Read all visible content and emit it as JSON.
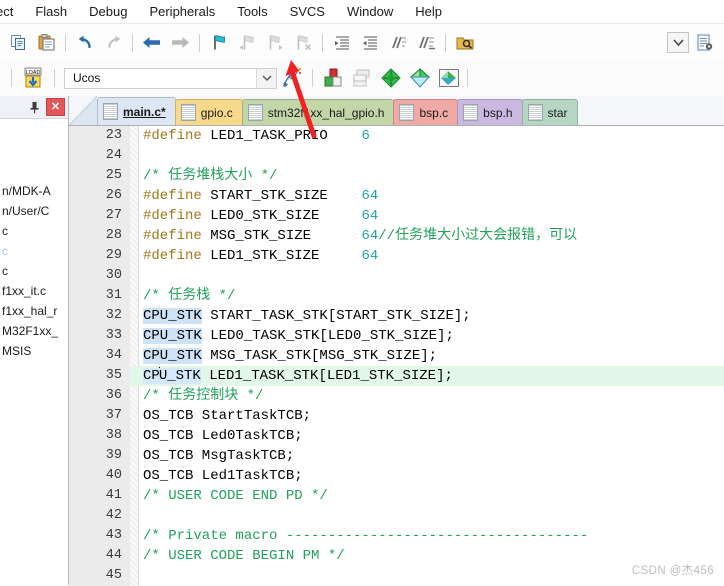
{
  "window": {
    "app": "Keil uVision IDE"
  },
  "menubar": {
    "items": [
      {
        "label": "ect",
        "name": "menu-project"
      },
      {
        "label": "Flash",
        "name": "menu-flash"
      },
      {
        "label": "Debug",
        "name": "menu-debug"
      },
      {
        "label": "Peripherals",
        "name": "menu-peripherals"
      },
      {
        "label": "Tools",
        "name": "menu-tools"
      },
      {
        "label": "SVCS",
        "name": "menu-svcs"
      },
      {
        "label": "Window",
        "name": "menu-window"
      },
      {
        "label": "Help",
        "name": "menu-help"
      }
    ]
  },
  "toolbar1": {
    "buttons": [
      {
        "icon": "copy-icon",
        "tooltip": "Copy"
      },
      {
        "icon": "paste-icon",
        "tooltip": "Paste"
      },
      {
        "icon": "undo-icon",
        "tooltip": "Undo"
      },
      {
        "icon": "redo-icon",
        "tooltip": "Redo"
      },
      {
        "icon": "navigate-back-icon",
        "tooltip": "Back"
      },
      {
        "icon": "navigate-forward-icon",
        "tooltip": "Forward"
      },
      {
        "icon": "bookmark-toggle-icon",
        "tooltip": "Insert/Remove Bookmark"
      },
      {
        "icon": "bookmark-prev-icon",
        "tooltip": "Previous Bookmark"
      },
      {
        "icon": "bookmark-next-icon",
        "tooltip": "Next Bookmark"
      },
      {
        "icon": "bookmark-clear-icon",
        "tooltip": "Clear All Bookmarks"
      },
      {
        "icon": "indent-increase-icon",
        "tooltip": "Indent Selected Text"
      },
      {
        "icon": "indent-decrease-icon",
        "tooltip": "Unindent Selected Text"
      },
      {
        "icon": "comment-lines-icon",
        "tooltip": "Comment Selection"
      },
      {
        "icon": "uncomment-lines-icon",
        "tooltip": "Uncomment Selection"
      },
      {
        "icon": "find-in-files-icon",
        "tooltip": "Find in Files"
      }
    ],
    "right": [
      {
        "icon": "chevron-down-icon",
        "tooltip": "Dropdown"
      },
      {
        "icon": "configure-file-icon",
        "tooltip": "Configuration Wizard"
      }
    ]
  },
  "toolbar2": {
    "load_icon_label": "LOAD",
    "target_value": "Ucos",
    "target_dropdown_icon": "chevron-down-icon",
    "buttons": [
      {
        "icon": "target-options-icon",
        "tooltip": "Options for Target"
      },
      {
        "icon": "manage-project-items-icon",
        "tooltip": "Manage Project Items"
      },
      {
        "icon": "pack-installer-icon",
        "tooltip": "Pack Installer"
      },
      {
        "icon": "manage-run-time-env-icon",
        "tooltip": "Manage Run-Time Environment"
      },
      {
        "icon": "select-software-packs-icon",
        "tooltip": "Select Software Packs"
      },
      {
        "icon": "multi-project-icon",
        "tooltip": "Multi-Project"
      }
    ]
  },
  "sidebar": {
    "pin_icon": "pin-icon",
    "close_icon": "close-icon",
    "tree_items": [
      {
        "label": "",
        "dim": false
      },
      {
        "label": "",
        "dim": false
      },
      {
        "label": "",
        "dim": false
      },
      {
        "label": "n/MDK-A",
        "dim": false
      },
      {
        "label": "n/User/C",
        "dim": false
      },
      {
        "label": "c",
        "dim": false
      },
      {
        "label": "c",
        "dim": true
      },
      {
        "label": "c",
        "dim": false
      },
      {
        "label": "f1xx_it.c",
        "dim": false
      },
      {
        "label": "f1xx_hal_r",
        "dim": false
      },
      {
        "label": "M32F1xx_",
        "dim": false
      },
      {
        "label": "MSIS",
        "dim": false
      }
    ]
  },
  "tabs": [
    {
      "label": "main.c*",
      "active": true,
      "color": "#dce7f3",
      "name": "tab-main-c"
    },
    {
      "label": "gpio.c",
      "active": false,
      "color": "#f7d98b",
      "name": "tab-gpio-c"
    },
    {
      "label": "stm32f1xx_hal_gpio.h",
      "active": false,
      "color": "#c3d6a8",
      "name": "tab-stm32f1xx-hal-gpio-h"
    },
    {
      "label": "bsp.c",
      "active": false,
      "color": "#f0a9a4",
      "name": "tab-bsp-c"
    },
    {
      "label": "bsp.h",
      "active": false,
      "color": "#cbb8e0",
      "name": "tab-bsp-h"
    },
    {
      "label": "star",
      "active": false,
      "color": "#b6d6c4",
      "name": "tab-startup-s"
    }
  ],
  "editor": {
    "first_line_number": 23,
    "lines": [
      {
        "n": 23,
        "hl": false,
        "tokens": [
          {
            "t": "#define ",
            "c": "pre"
          },
          {
            "t": "LED1_TASK_PRIO",
            "c": "plain"
          },
          {
            "t": "    ",
            "c": "plain"
          },
          {
            "t": "6",
            "c": "num"
          }
        ]
      },
      {
        "n": 24,
        "hl": false,
        "tokens": []
      },
      {
        "n": 25,
        "hl": false,
        "tokens": [
          {
            "t": "/* 任务堆栈大小 */",
            "c": "cmt"
          }
        ]
      },
      {
        "n": 26,
        "hl": false,
        "tokens": [
          {
            "t": "#define ",
            "c": "pre"
          },
          {
            "t": "START_STK_SIZE",
            "c": "plain"
          },
          {
            "t": "    ",
            "c": "plain"
          },
          {
            "t": "64",
            "c": "num"
          }
        ]
      },
      {
        "n": 27,
        "hl": false,
        "tokens": [
          {
            "t": "#define ",
            "c": "pre"
          },
          {
            "t": "LED0_STK_SIZE",
            "c": "plain"
          },
          {
            "t": "     ",
            "c": "plain"
          },
          {
            "t": "64",
            "c": "num"
          }
        ]
      },
      {
        "n": 28,
        "hl": false,
        "tokens": [
          {
            "t": "#define ",
            "c": "pre"
          },
          {
            "t": "MSG_STK_SIZE",
            "c": "plain"
          },
          {
            "t": "      ",
            "c": "plain"
          },
          {
            "t": "64",
            "c": "num"
          },
          {
            "t": "//任务堆大小过大会报错，可以",
            "c": "cmt"
          }
        ]
      },
      {
        "n": 29,
        "hl": false,
        "tokens": [
          {
            "t": "#define ",
            "c": "pre"
          },
          {
            "t": "LED1_STK_SIZE",
            "c": "plain"
          },
          {
            "t": "     ",
            "c": "plain"
          },
          {
            "t": "64",
            "c": "num"
          }
        ]
      },
      {
        "n": 30,
        "hl": false,
        "tokens": []
      },
      {
        "n": 31,
        "hl": false,
        "tokens": [
          {
            "t": "/* 任务栈 */",
            "c": "cmt"
          }
        ]
      },
      {
        "n": 32,
        "hl": false,
        "tokens": [
          {
            "t": "CPU_STK",
            "c": "sel"
          },
          {
            "t": " START_TASK_STK[START_STK_SIZE];",
            "c": "plain"
          }
        ]
      },
      {
        "n": 33,
        "hl": false,
        "tokens": [
          {
            "t": "CPU_STK",
            "c": "sel"
          },
          {
            "t": " LED0_TASK_STK[LED0_STK_SIZE];",
            "c": "plain"
          }
        ]
      },
      {
        "n": 34,
        "hl": false,
        "tokens": [
          {
            "t": "CPU_STK",
            "c": "sel"
          },
          {
            "t": " MSG_TASK_STK[MSG_STK_SIZE];",
            "c": "plain"
          }
        ]
      },
      {
        "n": 35,
        "hl": true,
        "tokens": [
          {
            "t": "CPU_STK",
            "c": "selcaret"
          },
          {
            "t": " LED1_TASK_STK[LED1_STK_SIZE];",
            "c": "plain"
          }
        ]
      },
      {
        "n": 36,
        "hl": false,
        "tokens": [
          {
            "t": "/* 任务控制块 */",
            "c": "cmt"
          }
        ]
      },
      {
        "n": 37,
        "hl": false,
        "tokens": [
          {
            "t": "OS_TCB StartTaskTCB;",
            "c": "plain"
          }
        ]
      },
      {
        "n": 38,
        "hl": false,
        "tokens": [
          {
            "t": "OS_TCB Led0TaskTCB;",
            "c": "plain"
          }
        ]
      },
      {
        "n": 39,
        "hl": false,
        "tokens": [
          {
            "t": "OS_TCB MsgTaskTCB;",
            "c": "plain"
          }
        ]
      },
      {
        "n": 40,
        "hl": false,
        "tokens": [
          {
            "t": "OS_TCB Led1TaskTCB;",
            "c": "plain"
          }
        ]
      },
      {
        "n": 41,
        "hl": false,
        "tokens": [
          {
            "t": "/* USER CODE END PD */",
            "c": "cmt"
          }
        ]
      },
      {
        "n": 42,
        "hl": false,
        "tokens": []
      },
      {
        "n": 43,
        "hl": false,
        "tokens": [
          {
            "t": "/* Private macro ------------------------------------",
            "c": "cmt"
          }
        ]
      },
      {
        "n": 44,
        "hl": false,
        "tokens": [
          {
            "t": "/* USER CODE BEGIN PM */",
            "c": "cmt"
          }
        ]
      },
      {
        "n": 45,
        "hl": false,
        "tokens": []
      }
    ]
  },
  "annotation": {
    "arrow_color": "#ee2222",
    "arrow_name": "red-pointer-arrow"
  },
  "watermark": {
    "text": "CSDN @杰456"
  },
  "colors": {
    "highlight_line": "#e3f7e8",
    "selection": "#cfe3f7",
    "comment": "#22a05a",
    "preprocessor": "#9c7a1b",
    "number": "#1ba8a0",
    "active_tab": "#dce7f3"
  }
}
